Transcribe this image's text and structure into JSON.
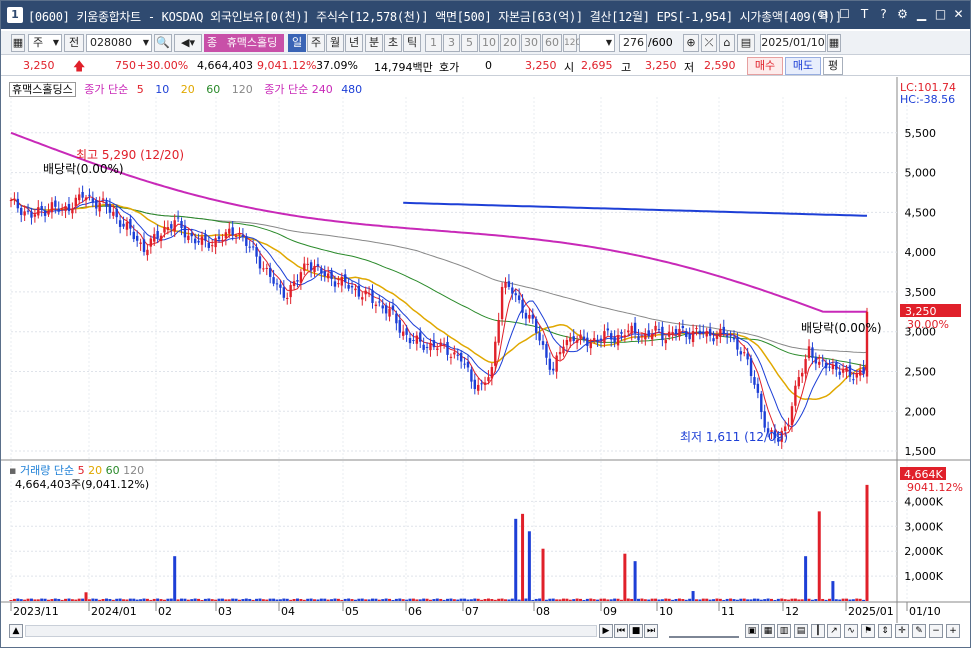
{
  "titlebar": {
    "number": "1",
    "title": "[0600] 키움종합차트 - KOSDAQ 외국인보유[0(천)] 주식수[12,578(천)] 액면[500] 자본금[63(억)] 결산[12월] EPS[-1,954] 시가총액[409(억)]",
    "icons": [
      "restore-icon",
      "window-icon",
      "text-icon",
      "tool-icon",
      "settings-icon",
      "minimize-icon",
      "maximize-icon",
      "close-icon"
    ]
  },
  "toolbar": {
    "market": "주",
    "prev": "전",
    "code": "028080",
    "stock_tag": "종",
    "stock_name": "휴맥스홀딩",
    "periods": [
      "일",
      "주",
      "월",
      "년",
      "분",
      "초",
      "틱"
    ],
    "selected_period": "일",
    "minute_options": [
      "1",
      "3",
      "5",
      "10",
      "20",
      "30",
      "60",
      "120"
    ],
    "count": "276",
    "count_total": "/600",
    "date": "2025/01/10"
  },
  "quote": {
    "price": "3,250",
    "change": "750",
    "change_pct": "+30.00%",
    "volume": "4,664,403",
    "vol_ratio": "9,041.12%",
    "turnover": "37.09%",
    "amount": "14,794백만",
    "hoga_label": "호가",
    "hoga_value": "0",
    "hoga_price": "3,250",
    "open_label": "시",
    "open": "2,695",
    "high_label": "고",
    "high": "3,250",
    "low_label": "저",
    "low": "2,590",
    "buy_label": "매수",
    "sell_label": "매도",
    "eval_label": "평"
  },
  "price_legend": {
    "name": "휴맥스홀딩스",
    "ma_label": "종가 단순",
    "ma_periods": [
      "5",
      "10",
      "20",
      "60",
      "120"
    ],
    "ma240_label": "종가 단순 240",
    "ma480": "480"
  },
  "indicators": {
    "lc": "LC:101.74",
    "hc": "HC:-38.56"
  },
  "annotations": {
    "high": "최고 5,290 (12/20)",
    "low": "최저 1,611 (12/09)",
    "dividend": "배당락(0.00%)",
    "last_price": "3,250",
    "last_pct": "30.00%"
  },
  "volume_legend": {
    "label": "거래량",
    "ma_label": "단순",
    "ma_periods": [
      "5",
      "20",
      "60",
      "120"
    ],
    "value": "4,664,403주(9,041.12%)",
    "last_vol": "4,664K",
    "last_pct": "9041.12%"
  },
  "colors": {
    "up": "#e0202a",
    "down": "#1d3fd6",
    "ma5": "#e0202a",
    "ma10": "#1d3fd6",
    "ma20": "#e0a800",
    "ma60": "#2a8a2a",
    "ma120": "#888888",
    "ma240": "#c829b8",
    "ma480": "#1d3fd6"
  },
  "chart_data": [
    {
      "type": "candlestick",
      "title": "휴맥스홀딩스",
      "y_ticks": [
        1500,
        2000,
        2500,
        3000,
        3500,
        4000,
        4500,
        5000,
        5500
      ],
      "y_tick_labels": [
        "1,500",
        "2,000",
        "2,500",
        "3,000",
        "3,500",
        "4,000",
        "4,500",
        "5,000",
        "5,500"
      ],
      "ylim": [
        1400,
        5950
      ],
      "x_labels": [
        "2023/11",
        "2024/01",
        "02",
        "03",
        "04",
        "05",
        "06",
        "07",
        "08",
        "09",
        "10",
        "11",
        "12",
        "2025/01",
        "01/10"
      ],
      "close_path": [
        [
          0,
          4620
        ],
        [
          3,
          4550
        ],
        [
          6,
          4450
        ],
        [
          9,
          4520
        ],
        [
          12,
          4580
        ],
        [
          15,
          4500
        ],
        [
          18,
          4620
        ],
        [
          21,
          4700
        ],
        [
          24,
          4650
        ],
        [
          27,
          4600
        ],
        [
          30,
          4480
        ],
        [
          33,
          4350
        ],
        [
          36,
          4200
        ],
        [
          39,
          4050
        ],
        [
          42,
          4150
        ],
        [
          45,
          4300
        ],
        [
          48,
          4380
        ],
        [
          51,
          4250
        ],
        [
          54,
          4150
        ],
        [
          57,
          4100
        ],
        [
          60,
          4150
        ],
        [
          63,
          4200
        ],
        [
          66,
          4280
        ],
        [
          69,
          4100
        ],
        [
          72,
          3950
        ],
        [
          75,
          3750
        ],
        [
          78,
          3550
        ],
        [
          81,
          3480
        ],
        [
          84,
          3650
        ],
        [
          87,
          3900
        ],
        [
          90,
          3750
        ],
        [
          93,
          3700
        ],
        [
          96,
          3620
        ],
        [
          99,
          3580
        ],
        [
          102,
          3500
        ],
        [
          105,
          3420
        ],
        [
          108,
          3350
        ],
        [
          111,
          3250
        ],
        [
          114,
          3050
        ],
        [
          117,
          2900
        ],
        [
          120,
          2850
        ],
        [
          123,
          2830
        ],
        [
          126,
          2800
        ],
        [
          129,
          2750
        ],
        [
          132,
          2650
        ],
        [
          135,
          2400
        ],
        [
          138,
          2300
        ],
        [
          141,
          2500
        ],
        [
          144,
          3600
        ],
        [
          147,
          3500
        ],
        [
          150,
          3300
        ],
        [
          153,
          3100
        ],
        [
          156,
          2800
        ],
        [
          159,
          2500
        ],
        [
          162,
          2850
        ],
        [
          165,
          2950
        ],
        [
          168,
          2850
        ],
        [
          171,
          2900
        ],
        [
          174,
          2950
        ],
        [
          177,
          2920
        ],
        [
          180,
          3000
        ],
        [
          183,
          2980
        ],
        [
          186,
          2950
        ],
        [
          189,
          3000
        ],
        [
          192,
          2950
        ],
        [
          195,
          3000
        ],
        [
          198,
          2980
        ],
        [
          201,
          3000
        ],
        [
          204,
          2950
        ],
        [
          207,
          2980
        ],
        [
          210,
          2950
        ],
        [
          213,
          2850
        ],
        [
          216,
          2600
        ],
        [
          219,
          2200
        ],
        [
          222,
          1700
        ],
        [
          225,
          1650
        ],
        [
          228,
          1900
        ],
        [
          231,
          2400
        ],
        [
          234,
          2800
        ],
        [
          237,
          2550
        ],
        [
          240,
          2600
        ],
        [
          243,
          2500
        ],
        [
          246,
          2450
        ],
        [
          249,
          2500
        ]
      ],
      "last_close": 3250,
      "period_high": 5290,
      "period_low": 1611
    },
    {
      "type": "bar",
      "title": "거래량",
      "y_ticks": [
        1000,
        2000,
        3000,
        4000
      ],
      "y_tick_labels": [
        "1,000K",
        "2,000K",
        "3,000K",
        "4,000K"
      ],
      "ylim": [
        0,
        4900
      ],
      "spikes": [
        [
          22,
          350,
          "up"
        ],
        [
          48,
          1800,
          "down"
        ],
        [
          148,
          3300,
          "down"
        ],
        [
          150,
          3500,
          "up"
        ],
        [
          152,
          2800,
          "down"
        ],
        [
          156,
          2100,
          "up"
        ],
        [
          180,
          1900,
          "up"
        ],
        [
          183,
          1600,
          "down"
        ],
        [
          200,
          400,
          "down"
        ],
        [
          233,
          1800,
          "down"
        ],
        [
          237,
          3600,
          "up"
        ],
        [
          241,
          800,
          "down"
        ],
        [
          251,
          4664,
          "up"
        ]
      ],
      "last_volume_k": 4664
    }
  ]
}
